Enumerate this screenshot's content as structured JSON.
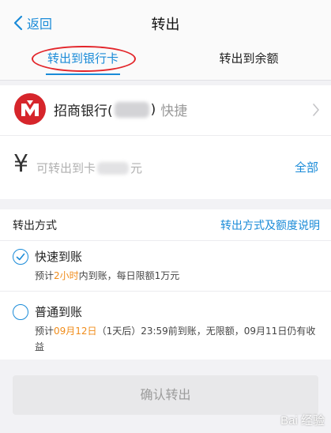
{
  "nav": {
    "back_label": "返回",
    "title": "转出"
  },
  "tabs": [
    {
      "label": "转出到银行卡",
      "active": true
    },
    {
      "label": "转出到余额",
      "active": false
    }
  ],
  "bank": {
    "name": "招商银行(",
    "suffix": ")",
    "tag": "快捷",
    "logo_icon": "cmb-bank-logo"
  },
  "amount": {
    "currency": "¥",
    "placeholder_prefix": "可转出到卡",
    "placeholder_suffix": "元",
    "all_label": "全部"
  },
  "method": {
    "label": "转出方式",
    "link": "转出方式及额度说明",
    "options": [
      {
        "title": "快速到账",
        "selected": true,
        "desc": [
          "预计",
          "2小时",
          "内到账，每日限额1万元"
        ]
      },
      {
        "title": "普通到账",
        "selected": false,
        "desc": [
          "预计",
          "09月12日",
          "（1天后）23:59前到账，无限额，09月11日仍有收益"
        ]
      }
    ]
  },
  "confirm_label": "确认转出",
  "watermark": "Bai 经验",
  "colors": {
    "accent": "#1a8bd8",
    "highlight": "#f08c1a",
    "bank_red": "#d6252b",
    "annotation_red": "#e3262b"
  }
}
